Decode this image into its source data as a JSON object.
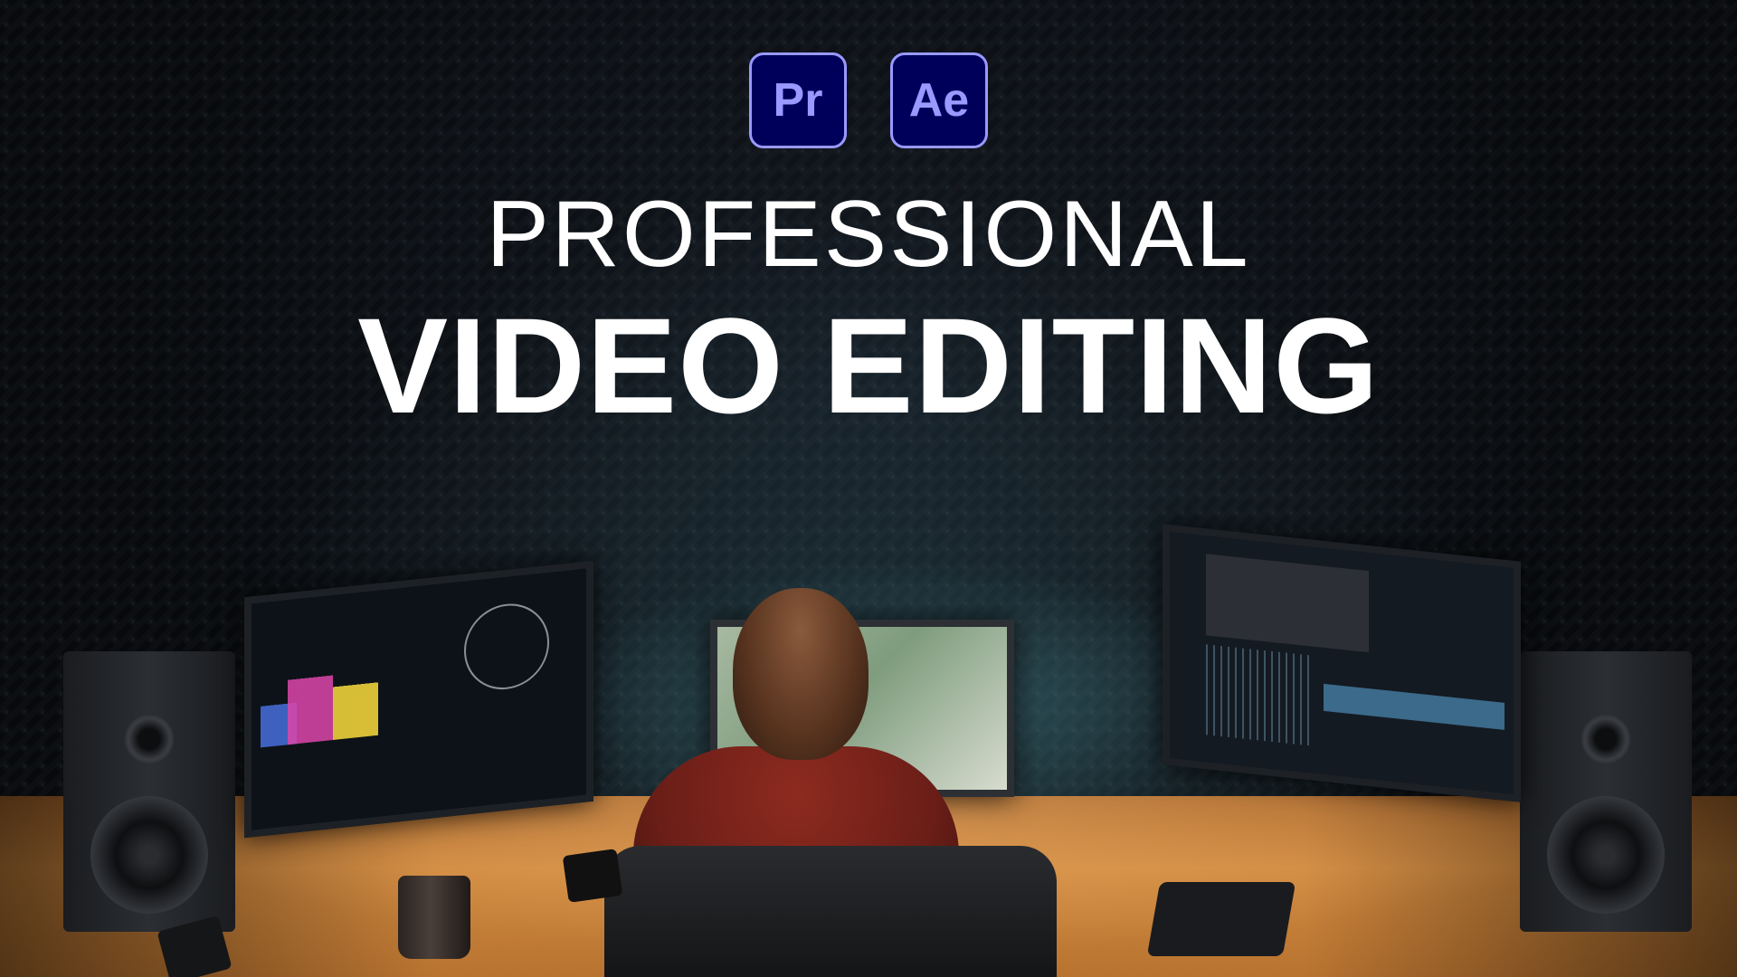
{
  "logos": {
    "premiere": "Pr",
    "after_effects": "Ae",
    "accent_color": "#9999ff",
    "badge_color": "#00005b"
  },
  "headline": {
    "line1": "PROFESSIONAL",
    "line2": "VIDEO EDITING",
    "text_color": "#ffffff"
  },
  "scene": {
    "background_color": "#07090c",
    "desk_color": "#c57d38",
    "sweater_color": "#7a231b"
  }
}
